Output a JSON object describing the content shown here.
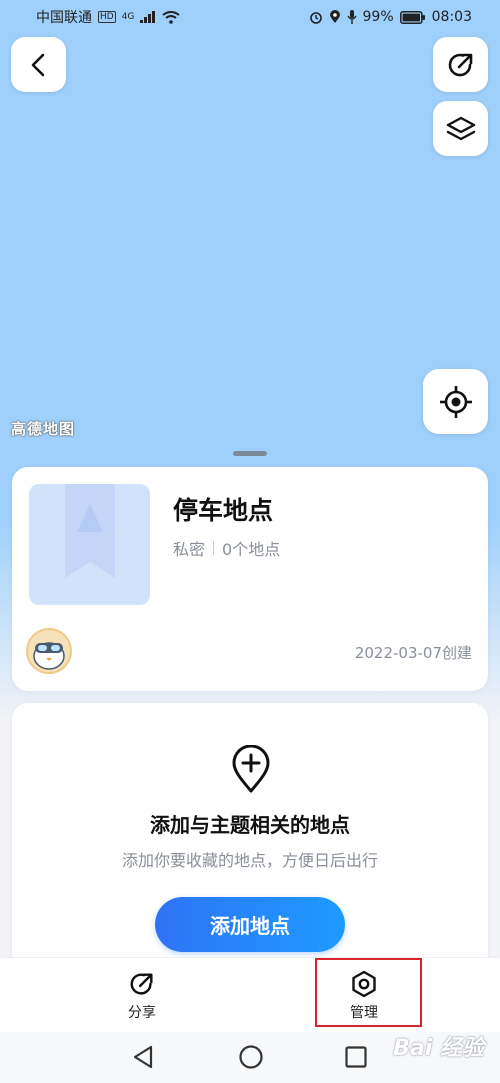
{
  "status_bar": {
    "carrier": "中国联通",
    "network_badge": "HD",
    "signal": "4G",
    "battery": "99%",
    "time": "08:03"
  },
  "map": {
    "provider_logo": "高德地图"
  },
  "icons": {
    "back": "chevron-left-icon",
    "share": "share-arrow-icon",
    "layers": "layers-icon",
    "locate": "crosshair-icon",
    "add_place": "add-location-pin-icon",
    "manage": "hexagon-gear-icon"
  },
  "favorite_list": {
    "title": "停车地点",
    "privacy": "私密",
    "count": "0个地点",
    "created": "2022-03-07创建"
  },
  "empty_state": {
    "title": "添加与主题相关的地点",
    "subtitle": "添加你要收藏的地点，方便日后出行",
    "add_button": "添加地点"
  },
  "bottom_bar": {
    "share_label": "分享",
    "manage_label": "管理"
  },
  "watermark": {
    "text": "Bai 经验"
  },
  "colors": {
    "map_bg": "#9fd0fb",
    "accent": "#2f73f5",
    "highlight": "#d9262c"
  }
}
